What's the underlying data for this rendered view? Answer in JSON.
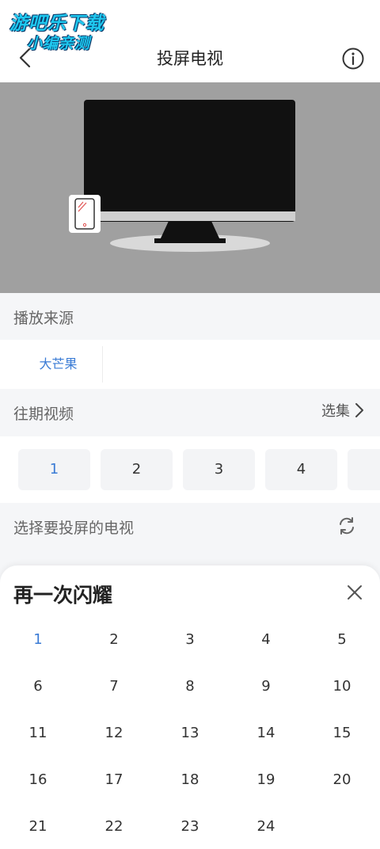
{
  "watermark": {
    "line1": "游吧乐下载",
    "line2": "小编亲测"
  },
  "header": {
    "title": "投屏电视",
    "back_icon": "chevron-left-icon",
    "info_icon": "info-circle-icon"
  },
  "source_section": {
    "title": "播放来源",
    "items": [
      {
        "label": "大芒果",
        "active": true
      }
    ]
  },
  "episodes_section": {
    "title": "往期视频",
    "select_label": "选集",
    "chips": [
      {
        "label": "1",
        "active": true
      },
      {
        "label": "2"
      },
      {
        "label": "3"
      },
      {
        "label": "4"
      },
      {
        "label": ""
      }
    ]
  },
  "tv_section": {
    "title": "选择要投屏的电视",
    "refresh_icon": "refresh-icon"
  },
  "sheet": {
    "title": "再一次闪耀",
    "close_icon": "close-icon",
    "episodes": [
      "1",
      "2",
      "3",
      "4",
      "5",
      "6",
      "7",
      "8",
      "9",
      "10",
      "11",
      "12",
      "13",
      "14",
      "15",
      "16",
      "17",
      "18",
      "19",
      "20",
      "21",
      "22",
      "23",
      "24"
    ],
    "active_episode": "1"
  },
  "colors": {
    "accent": "#3a7bd5",
    "preview_bg": "#a0a0a0",
    "page_bg": "#f5f6f8"
  }
}
